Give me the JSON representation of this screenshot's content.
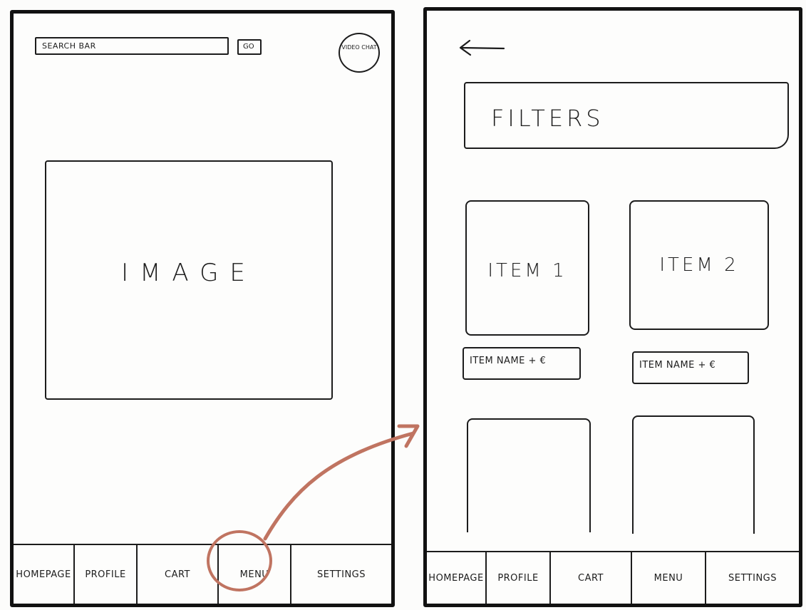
{
  "home_screen": {
    "search": {
      "placeholder": "SEARCH BAR",
      "go_label": "GO"
    },
    "video_chat_label": "VIDEO CHAT",
    "image_label": "IMAGE"
  },
  "menu_screen": {
    "filters_label": "FILTERS",
    "items": [
      {
        "label": "ITEM 1",
        "name_price": "ITEM NAME + €"
      },
      {
        "label": "ITEM 2",
        "name_price": "ITEM NAME + €"
      }
    ]
  },
  "bottom_nav": {
    "items": [
      "HOMEPAGE",
      "PROFILE",
      "CART",
      "MENU",
      "SETTINGS"
    ]
  },
  "colors": {
    "ink": "#1c1c1c",
    "highlight": "#c07461",
    "paper": "#fdfdfc"
  }
}
